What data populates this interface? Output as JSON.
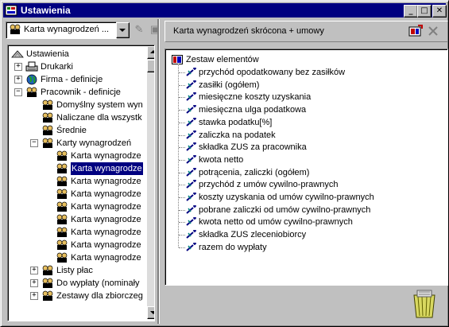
{
  "window": {
    "title": "Ustawienia",
    "controls": [
      "minimize",
      "maximize",
      "close"
    ]
  },
  "left_panel": {
    "combo_value": "Karta wynagrodzeń ...",
    "tree": [
      {
        "label": "Ustawienia",
        "level": 0,
        "icon": "tree-root-icon",
        "expander": ""
      },
      {
        "label": "Drukarki",
        "level": 1,
        "icon": "printer-icon",
        "expander": "+"
      },
      {
        "label": "Firma - definicje",
        "level": 1,
        "icon": "globe-icon",
        "expander": "+"
      },
      {
        "label": "Pracownik - definicje",
        "level": 1,
        "icon": "people-icon",
        "expander": "-"
      },
      {
        "label": "Domyślny system wyn",
        "level": 2,
        "icon": "people-icon",
        "expander": ""
      },
      {
        "label": "Naliczane dla wszystk",
        "level": 2,
        "icon": "people-icon",
        "expander": ""
      },
      {
        "label": "Średnie",
        "level": 2,
        "icon": "people-icon",
        "expander": ""
      },
      {
        "label": "Karty wynagrodzeń",
        "level": 2,
        "icon": "people-icon",
        "expander": "-"
      },
      {
        "label": "Karta wynagrodze",
        "level": 3,
        "icon": "people-icon",
        "expander": ""
      },
      {
        "label": "Karta wynagrodze",
        "level": 3,
        "icon": "people-icon",
        "expander": "",
        "selected": true
      },
      {
        "label": "Karta wynagrodze",
        "level": 3,
        "icon": "people-icon",
        "expander": ""
      },
      {
        "label": "Karta wynagrodze",
        "level": 3,
        "icon": "people-icon",
        "expander": ""
      },
      {
        "label": "Karta wynagrodze",
        "level": 3,
        "icon": "people-icon",
        "expander": ""
      },
      {
        "label": "Karta wynagrodze",
        "level": 3,
        "icon": "people-icon",
        "expander": ""
      },
      {
        "label": "Karta wynagrodze",
        "level": 3,
        "icon": "people-icon",
        "expander": ""
      },
      {
        "label": "Karta wynagrodze",
        "level": 3,
        "icon": "people-icon",
        "expander": ""
      },
      {
        "label": "Karta wynagrodze",
        "level": 3,
        "icon": "people-icon",
        "expander": ""
      },
      {
        "label": "Listy płac",
        "level": 2,
        "icon": "people-icon",
        "expander": "+"
      },
      {
        "label": "Do wypłaty (nominały",
        "level": 2,
        "icon": "people-icon",
        "expander": "+"
      },
      {
        "label": "Zestawy dla zbiorczeg",
        "level": 2,
        "icon": "people-icon",
        "expander": "+"
      }
    ]
  },
  "right_panel": {
    "header_title": "Karta wynagrodzeń skrócona + umowy",
    "root_label": "Zestaw elementów",
    "elements": [
      "przychód opodatkowany bez zasiłków",
      "zasiłki (ogółem)",
      "miesięczne koszty uzyskania",
      "miesięczna ulga podatkowa",
      "stawka podatku[%]",
      "zaliczka na podatek",
      "składka ZUS za pracownika",
      "kwota netto",
      "potrącenia, zaliczki (ogółem)",
      "przychód z umów cywilno-prawnych",
      "koszty uzyskania od umów cywilno-prawnych",
      "pobrane zaliczki od umów cywilno-prawnych",
      "kwota netto od umów cywilno-prawnych",
      "składka ZUS zleceniobiorcy",
      "razem do wypłaty"
    ]
  },
  "colors": {
    "titlebar": "#000080",
    "selection": "#000080",
    "face": "#c0c0c0"
  }
}
